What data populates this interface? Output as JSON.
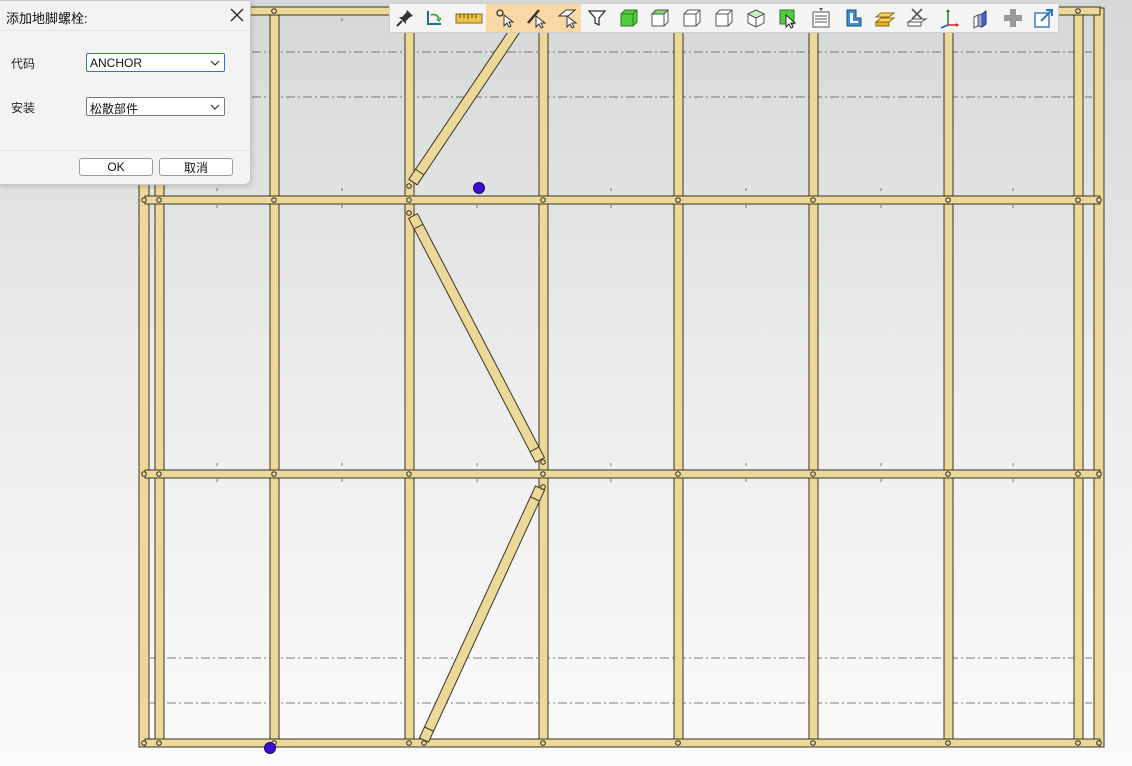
{
  "dialog": {
    "title": "添加地脚螺栓:",
    "code_label": "代码",
    "code_value": "ANCHOR",
    "install_label": "安装",
    "install_value": "松散部件",
    "ok_label": "OK",
    "cancel_label": "取消"
  },
  "toolbar": {
    "highlight_color": "#f8d9a6",
    "buttons": [
      "pin-icon",
      "rotate-view-icon",
      "measure-ruler-icon",
      "select-point-icon",
      "select-member-icon",
      "select-plate-icon",
      "filter-icon",
      "solid-view-icon",
      "wireframe-view-icon",
      "front-view-icon",
      "right-view-icon",
      "iso-view-icon",
      "select-object-icon",
      "properties-icon",
      "member-profile-icon",
      "plate-stack-icon",
      "delete-icon",
      "axes-icon",
      "render-icon",
      "add-icon",
      "export-icon"
    ]
  },
  "model": {
    "member_color": "#ecd898",
    "anchor_color": "#3a0fd0"
  }
}
